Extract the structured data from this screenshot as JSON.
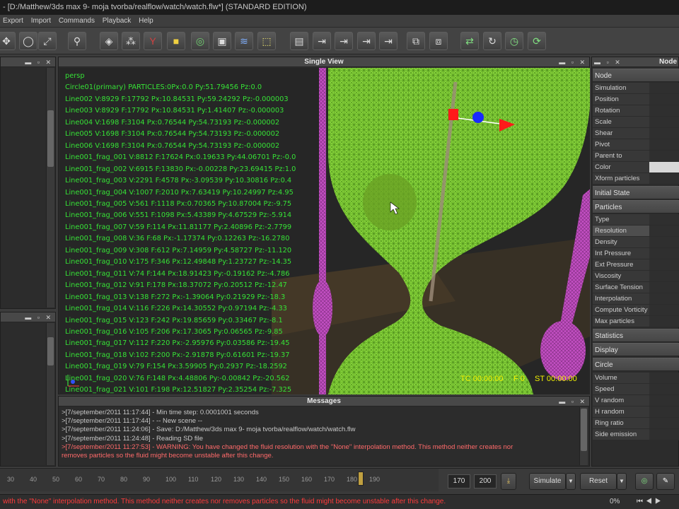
{
  "window": {
    "title": "- [D:/Matthew/3ds max 9- moja tvorba/realflow/watch/watch.flw*] (STANDARD EDITION)"
  },
  "menu": [
    "Export",
    "Import",
    "Commands",
    "Playback",
    "Help"
  ],
  "toolbar_icons": [
    "move-icon",
    "rotate-icon",
    "scale-icon",
    "axis-icon",
    "layers-icon",
    "nodes-icon",
    "daemon-icon",
    "object-icon",
    "emitter-icon",
    "camera-icon",
    "wave-icon",
    "mesh-icon",
    "grid-icon",
    "export-icon",
    "export2-icon",
    "export3-icon",
    "export4-icon",
    "cube-icon",
    "render-icon",
    "script-icon",
    "graph-icon",
    "clock-icon",
    "reload-icon"
  ],
  "view": {
    "title": "Single View",
    "lines": [
      "persp",
      "Circle01(primary) PARTICLES:0Px:0.0 Py:51.79456 Pz:0.0",
      "Line002 V:8929 F:17792 Px:10.84531 Py:59.24292 Pz:-0.000003",
      "Line003 V:8929 F:17792 Px:10.84531 Py:1.41407 Pz:-0.000003",
      "Line004 V:1698 F:3104 Px:0.76544 Py:54.73193 Pz:-0.000002",
      "Line005 V:1698 F:3104 Px:0.76544 Py:54.73193 Pz:-0.000002",
      "Line006 V:1698 F:3104 Px:0.76544 Py:54.73193 Pz:-0.000002",
      "Line001_frag_001 V:8812 F:17624 Px:0.19633 Py:44.06701 Pz:-0.0",
      "Line001_frag_002 V:6915 F:13830 Px:-0.00228 Py:23.69415 Pz:1.0",
      "Line001_frag_003 V:2291 F:4578 Px:-3.09539 Py:10.30816 Pz:0.4",
      "Line001_frag_004 V:1007 F:2010 Px:7.63419 Py:10.24997 Pz:4.95",
      "Line001_frag_005 V:561 F:1118 Px:0.70365 Py:10.87004 Pz:-9.75",
      "Line001_frag_006 V:551 F:1098 Px:5.43389 Py:4.67529 Pz:-5.914",
      "Line001_frag_007 V:59 F:114 Px:11.81177 Py:2.40896 Pz:-2.7799",
      "Line001_frag_008 V:36 F:68 Px:-1.17374 Py:0.12263 Pz:-16.2780",
      "Line001_frag_009 V:308 F:612 Px:7.14959 Py:4.58727 Pz:-11.120",
      "Line001_frag_010 V:175 F:346 Px:12.49848 Py:1.23727 Pz:-14.35",
      "Line001_frag_011 V:74 F:144 Px:18.91423 Py:-0.19162 Pz:-4.786",
      "Line001_frag_012 V:91 F:178 Px:18.37072 Py:0.20512 Pz:-12.47",
      "Line001_frag_013 V:138 F:272 Px:-1.39064 Py:0.21929 Pz:-18.3",
      "Line001_frag_014 V:116 F:226 Px:14.30552 Py:0.97194 Pz:-4.33",
      "Line001_frag_015 V:123 F:242 Px:19.85659 Py:0.33467 Pz:-8.1",
      "Line001_frag_016 V:105 F:206 Px:17.3065 Py:0.06565 Pz:-9.85",
      "Line001_frag_017 V:112 F:220 Px:-2.95976 Py:0.03586 Pz:-19.45",
      "Line001_frag_018 V:102 F:200 Px:-2.91878 Py:0.61601 Pz:-19.37",
      "Line001_frag_019 V:79 F:154 Px:3.59905 Py:0.2937 Pz:-18.2592",
      "Line001_frag_020 V:76 F:148 Px:4.48806 Py:-0.00842 Pz:-20.562",
      "Line001_frag_021 V:101 F:198 Px:12.51827 Py:2.35254 Pz:-7.325"
    ],
    "hud_tc": "TC 00:00:00",
    "hud_f": "F 0",
    "hud_st": "ST 00:00:00"
  },
  "messages": {
    "title": "Messages",
    "lines": [
      {
        "text": ">[7/september/2011 11:17:44] - Min time step: 0.0001001 seconds",
        "warn": false
      },
      {
        "text": ">[7/september/2011 11:17:44] - -- New scene --",
        "warn": false
      },
      {
        "text": ">[7/september/2011 11:24:06] - Save: D:/Matthew/3ds max 9- moja tvorba/realflow/watch/watch.flw",
        "warn": false
      },
      {
        "text": ">[7/september/2011 11:24:48] - Reading SD file",
        "warn": false
      },
      {
        "text": ">[7/september/2011 11:27:53] - WARNING: You have changed the fluid resolution  with the \"None\" interpolation method. This method  neither creates nor",
        "warn": true
      },
      {
        "text": "removes particles so the  fluid might become unstable after this change.",
        "warn": true
      }
    ]
  },
  "node_panel": {
    "title": "Node",
    "rows_top": [
      "Node",
      "Simulation",
      "Position",
      "Rotation",
      "Scale",
      "Shear",
      "Pivot",
      "Parent to",
      "Color",
      "Xform particles"
    ],
    "section_initial": "Initial State",
    "section_particles": "Particles",
    "rows_particles": [
      "Type",
      "Resolution",
      "Density",
      "Int Pressure",
      "Ext Pressure",
      "Viscosity",
      "Surface Tension",
      "Interpolation",
      "Compute Vorticity",
      "Max particles"
    ],
    "section_statistics": "Statistics",
    "section_display": "Display",
    "section_circle": "Circle",
    "rows_circle": [
      "Volume",
      "Speed",
      "V random",
      "H random",
      "Ring ratio",
      "Side emission"
    ]
  },
  "timeline": {
    "ticks": [
      "30",
      "40",
      "50",
      "60",
      "70",
      "80",
      "90",
      "100",
      "110",
      "120",
      "130",
      "140",
      "150",
      "160",
      "170",
      "180",
      "190"
    ],
    "end_frame": "170",
    "max_frame": "200",
    "simulate_label": "Simulate",
    "reset_label": "Reset",
    "progress": "0%"
  },
  "status": {
    "text": "with the \"None\" interpolation method.  This method  neither creates nor removes particles so the  fluid might become unstable after this change."
  },
  "colors": {
    "mesh_green": "#8ee03c",
    "info_text": "#36e236",
    "warning": "#ff6a6a",
    "magenta": "#c050c0"
  }
}
